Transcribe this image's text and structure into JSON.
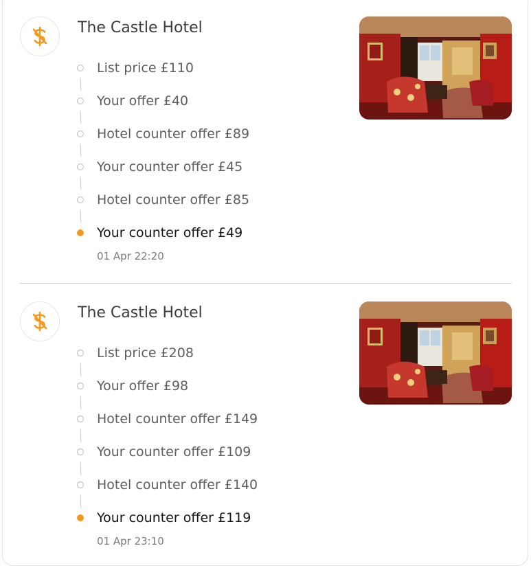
{
  "colors": {
    "accent": "#f39a1e"
  },
  "offers": [
    {
      "icon": "dollar-strike-icon",
      "hotel_name": "The Castle Hotel",
      "steps": [
        {
          "label": "List price £110",
          "active": false
        },
        {
          "label": "Your offer £40",
          "active": false
        },
        {
          "label": "Hotel counter offer £89",
          "active": false
        },
        {
          "label": "Your counter offer £45",
          "active": false
        },
        {
          "label": "Hotel counter offer £85",
          "active": false
        },
        {
          "label": "Your counter offer £49",
          "active": true
        }
      ],
      "timestamp": "01 Apr 22:20"
    },
    {
      "icon": "dollar-strike-icon",
      "hotel_name": "The Castle Hotel",
      "steps": [
        {
          "label": "List price £208",
          "active": false
        },
        {
          "label": "Your offer £98",
          "active": false
        },
        {
          "label": "Hotel counter offer £149",
          "active": false
        },
        {
          "label": "Your counter offer £109",
          "active": false
        },
        {
          "label": "Hotel counter offer £140",
          "active": false
        },
        {
          "label": "Your counter offer £119",
          "active": true
        }
      ],
      "timestamp": "01 Apr 23:10"
    }
  ]
}
